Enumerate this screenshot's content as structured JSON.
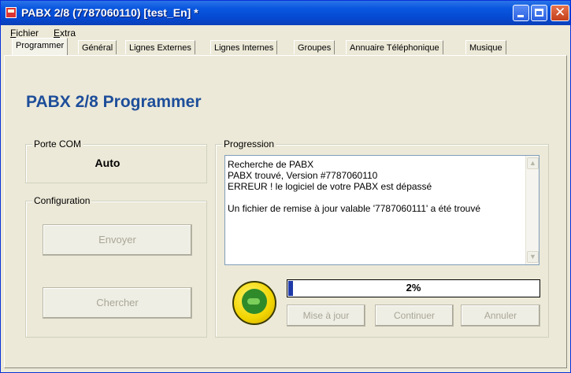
{
  "window": {
    "title": "PABX 2/8 (7787060110) [test_En] *"
  },
  "menubar": {
    "items": [
      {
        "label_rest": "ichier",
        "underlined": "F"
      },
      {
        "label_rest": "xtra",
        "underlined": "E"
      }
    ]
  },
  "tabs": [
    {
      "label": "Programmer",
      "active": true
    },
    {
      "label": "Général",
      "active": false
    },
    {
      "label": "Lignes Externes",
      "active": false
    },
    {
      "label": "Lignes Internes",
      "active": false
    },
    {
      "label": "Groupes",
      "active": false
    },
    {
      "label": "Annuaire Téléphonique",
      "active": false
    },
    {
      "label": "Musique",
      "active": false
    }
  ],
  "main": {
    "heading": "PABX 2/8 Programmer",
    "porte_com": {
      "label": "Porte COM",
      "value": "Auto"
    },
    "configuration": {
      "label": "Configuration",
      "send_button": "Envoyer",
      "search_button": "Chercher"
    },
    "progression": {
      "label": "Progression",
      "log_lines": [
        "Recherche de PABX",
        "PABX trouvé, Version #7787060110",
        "ERREUR ! le logiciel de votre PABX est dépassé",
        "",
        "Un fichier de remise à jour valable '7787060111' a été trouvé"
      ],
      "progress_percent": 2,
      "progress_label": "2%",
      "buttons": {
        "update": "Mise à jour",
        "continue": "Continuer",
        "cancel": "Annuler"
      }
    }
  },
  "icons": {
    "app": "app-icon",
    "logo": "smiley-logo-icon",
    "scroll_up": "scroll-up-icon",
    "scroll_down": "scroll-down-icon"
  },
  "colors": {
    "titlebar": "#0549d1",
    "heading": "#1e4e9a",
    "progress_fill": "#1f3aa8"
  }
}
